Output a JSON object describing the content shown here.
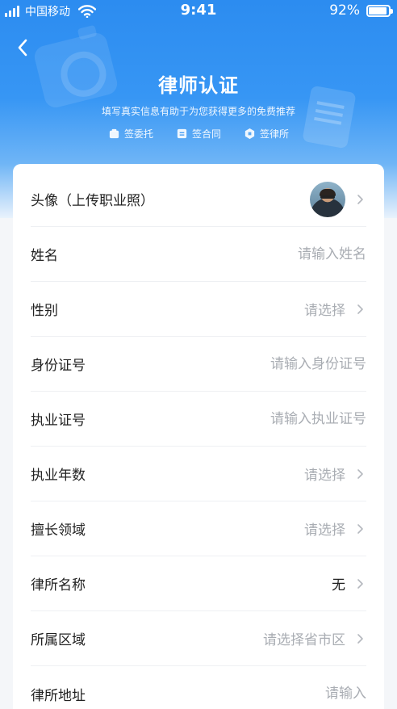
{
  "status_bar": {
    "carrier": "中国移动",
    "time": "9:41",
    "battery": "92%"
  },
  "header": {
    "title": "律师认证",
    "subtitle": "填写真实信息有助于为您获得更多的免费推荐",
    "features": [
      {
        "label": "签委托",
        "icon": "entrust-icon"
      },
      {
        "label": "签合同",
        "icon": "contract-icon"
      },
      {
        "label": "签律所",
        "icon": "law-firm-icon"
      }
    ]
  },
  "form": {
    "avatar": {
      "label": "头像（上传职业照）"
    },
    "name": {
      "label": "姓名",
      "placeholder": "请输入姓名"
    },
    "gender": {
      "label": "性别",
      "value": "请选择"
    },
    "id_number": {
      "label": "身份证号",
      "placeholder": "请输入身份证号"
    },
    "license_number": {
      "label": "执业证号",
      "placeholder": "请输入执业证号"
    },
    "years": {
      "label": "执业年数",
      "value": "请选择"
    },
    "specialty": {
      "label": "擅长领域",
      "value": "请选择"
    },
    "firm_name": {
      "label": "律所名称",
      "value": "无"
    },
    "region": {
      "label": "所属区域",
      "value": "请选择省市区"
    },
    "firm_address": {
      "label": "律所地址",
      "placeholder": "请输入"
    }
  },
  "colors": {
    "primary": "#2c8cf0",
    "placeholder": "#a9adb3",
    "text": "#222222",
    "background": "#f4f6f9"
  }
}
